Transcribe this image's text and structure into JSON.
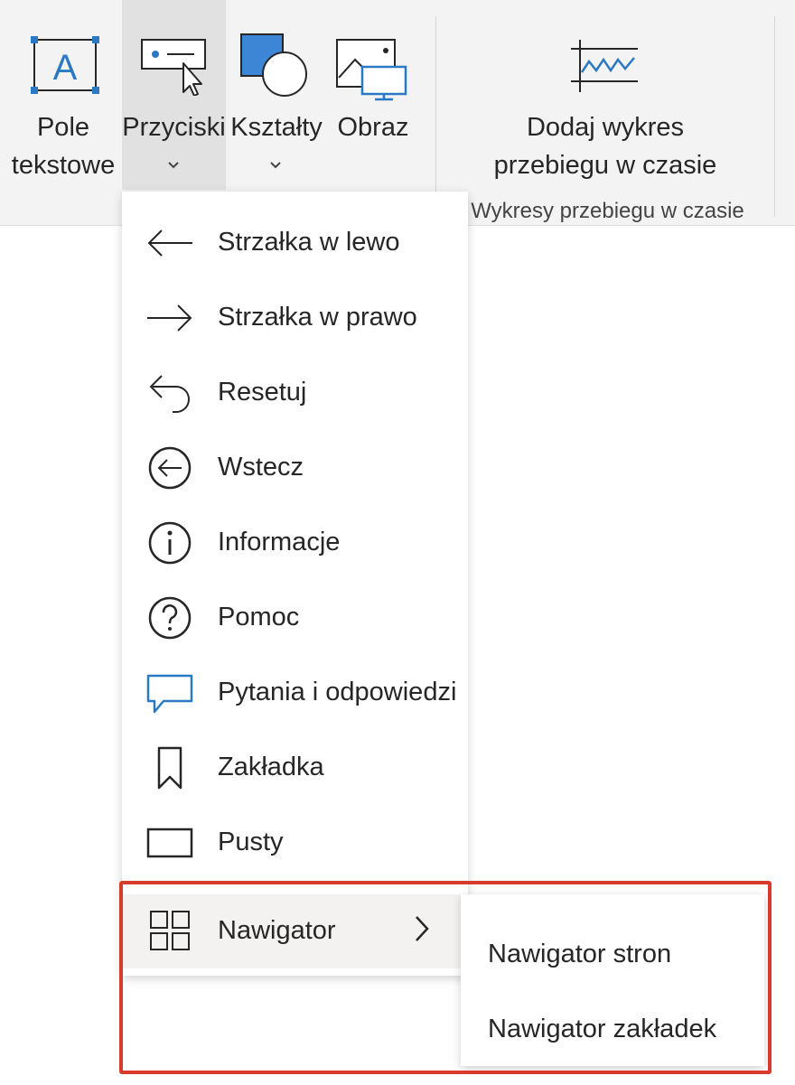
{
  "ribbon": {
    "buttons": [
      {
        "label_line1": "Pole",
        "label_line2": "tekstowe",
        "icon": "text-box-icon"
      },
      {
        "label": "Przyciski",
        "icon": "buttons-icon",
        "dropdown": true
      },
      {
        "label": "Kształty",
        "icon": "shapes-icon",
        "dropdown": true
      },
      {
        "label": "Obraz",
        "icon": "image-icon"
      },
      {
        "label_line1": "Dodaj wykres",
        "label_line2": "przebiegu w czasie",
        "icon": "timeline-chart-icon"
      }
    ],
    "group_label": "Wykresy przebiegu w czasie"
  },
  "menu": {
    "items": [
      {
        "label": "Strzałka w lewo",
        "icon": "arrow-left-icon"
      },
      {
        "label": "Strzałka w prawo",
        "icon": "arrow-right-icon"
      },
      {
        "label": "Resetuj",
        "icon": "reset-icon"
      },
      {
        "label": "Wstecz",
        "icon": "back-circle-icon"
      },
      {
        "label": "Informacje",
        "icon": "info-icon"
      },
      {
        "label": "Pomoc",
        "icon": "help-icon"
      },
      {
        "label": "Pytania i odpowiedzi",
        "icon": "qna-bubble-icon"
      },
      {
        "label": "Zakładka",
        "icon": "bookmark-icon"
      },
      {
        "label": "Pusty",
        "icon": "blank-rectangle-icon"
      },
      {
        "label": "Nawigator",
        "icon": "navigator-grid-icon",
        "has_submenu": true
      }
    ]
  },
  "submenu": {
    "items": [
      {
        "label": "Nawigator stron"
      },
      {
        "label": "Nawigator zakładek"
      }
    ]
  },
  "colors": {
    "accent_blue": "#2b79c2",
    "highlight_red": "#d83b2c",
    "ribbon_bg": "#f3f3f3",
    "selected_bg": "#e1e1e1"
  }
}
